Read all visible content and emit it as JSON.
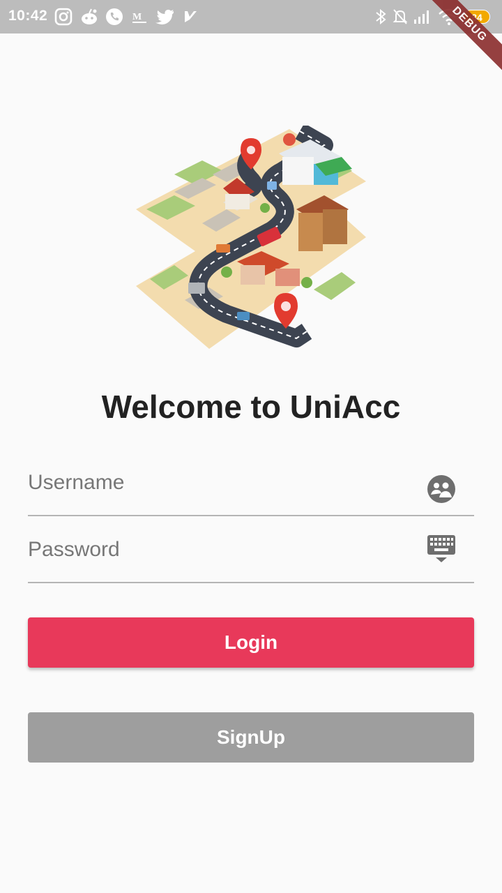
{
  "status_bar": {
    "time": "10:42",
    "battery": "84",
    "left_icons": [
      "instagram-icon",
      "reddit-icon",
      "whatsapp-icon",
      "gmail-icon",
      "twitter-icon",
      "app-icon"
    ],
    "right_icons": [
      "bluetooth-icon",
      "notifications-off-icon",
      "signal-icon",
      "wifi-icon"
    ]
  },
  "debug_banner": "DEBUG",
  "illustration": "city-map-illustration",
  "title": "Welcome to UniAcc",
  "form": {
    "username": {
      "placeholder": "Username",
      "value": "",
      "icon": "account-group-icon"
    },
    "password": {
      "placeholder": "Password",
      "value": "",
      "icon": "keyboard-icon"
    }
  },
  "buttons": {
    "login": "Login",
    "signup": "SignUp"
  },
  "colors": {
    "primary": "#e8395a",
    "secondary": "#9e9e9e",
    "status_bar": "#bcbcbc"
  }
}
